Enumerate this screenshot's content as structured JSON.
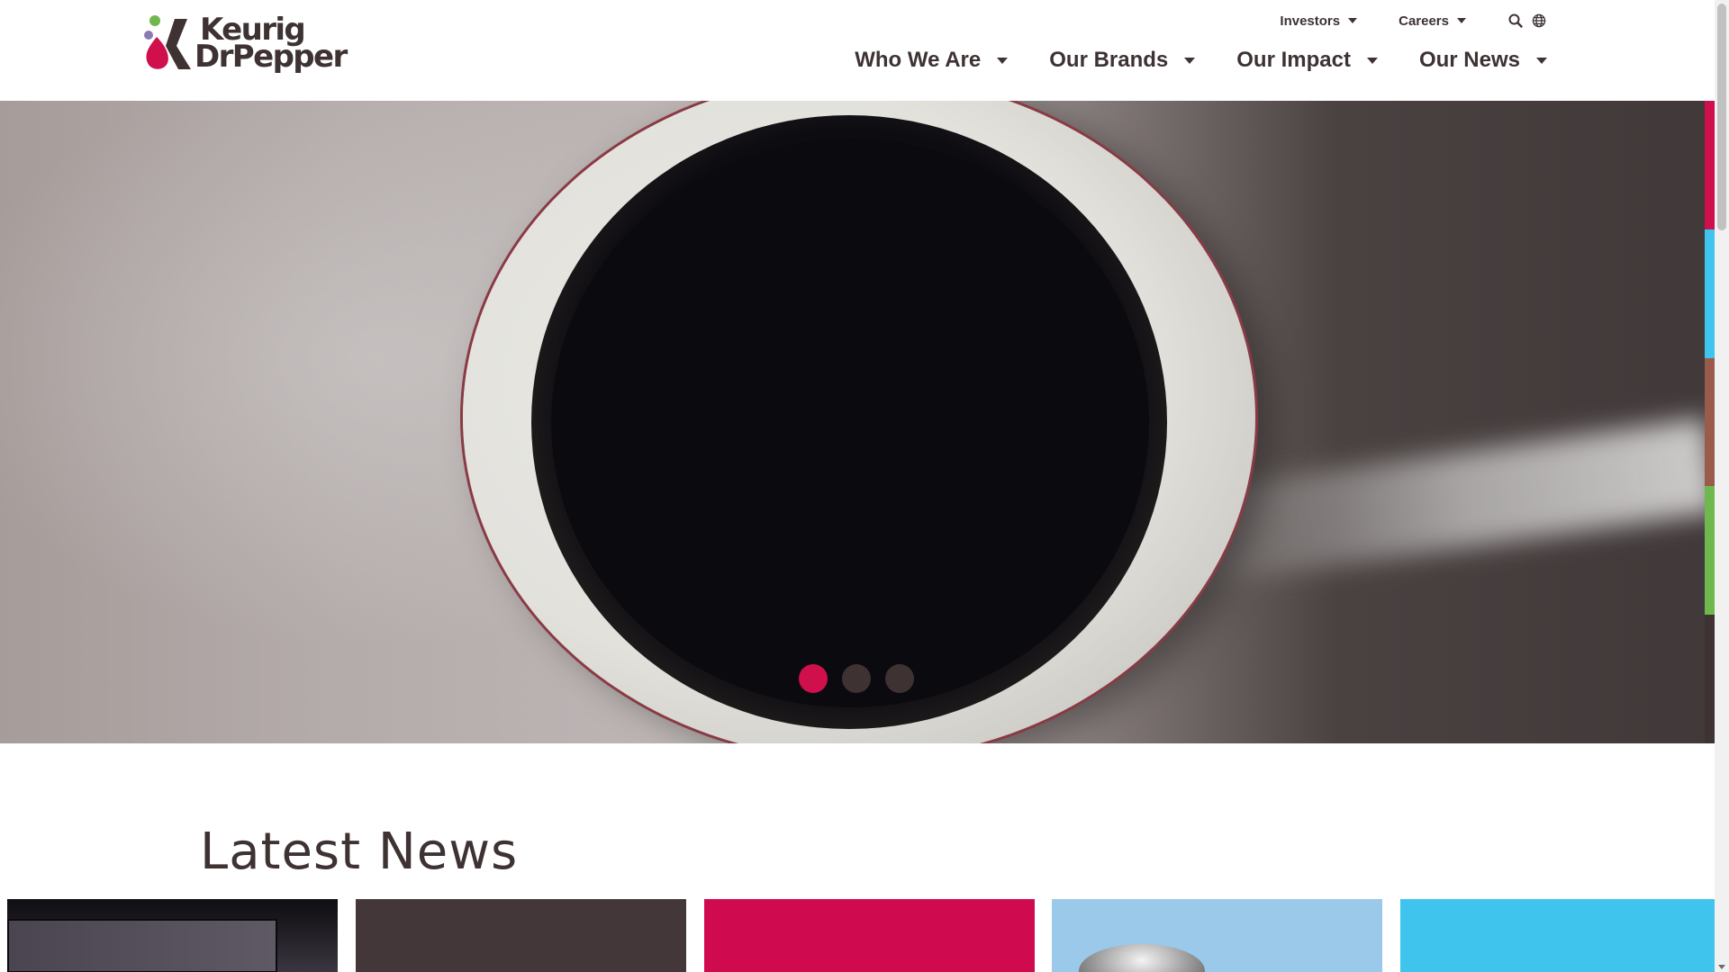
{
  "brand": {
    "logo_line1": "Keurig",
    "logo_line2": "DrPepper",
    "colors": {
      "magenta": "#d0104c",
      "green": "#6fb84d",
      "purple": "#8c7bb0",
      "text": "#3e3233"
    }
  },
  "utility_nav": {
    "items": [
      {
        "label": "Investors"
      },
      {
        "label": "Careers"
      }
    ],
    "icons": [
      "search-icon",
      "globe-icon"
    ]
  },
  "main_nav": {
    "items": [
      {
        "label": "Who We Are"
      },
      {
        "label": "Our Brands"
      },
      {
        "label": "Our Impact"
      },
      {
        "label": "Our News"
      }
    ]
  },
  "hero": {
    "slide_count": 3,
    "active_slide": 1,
    "side_tab_colors": [
      "#d0104c",
      "#3fc4ee",
      "#9a5a4c",
      "#6fb84d",
      "#3e3233"
    ]
  },
  "news": {
    "heading": "Latest News",
    "card_colors": [
      "#1a171d",
      "#443739",
      "#cf0a4e",
      "#9ac9ea",
      "#3fc4ee"
    ]
  }
}
